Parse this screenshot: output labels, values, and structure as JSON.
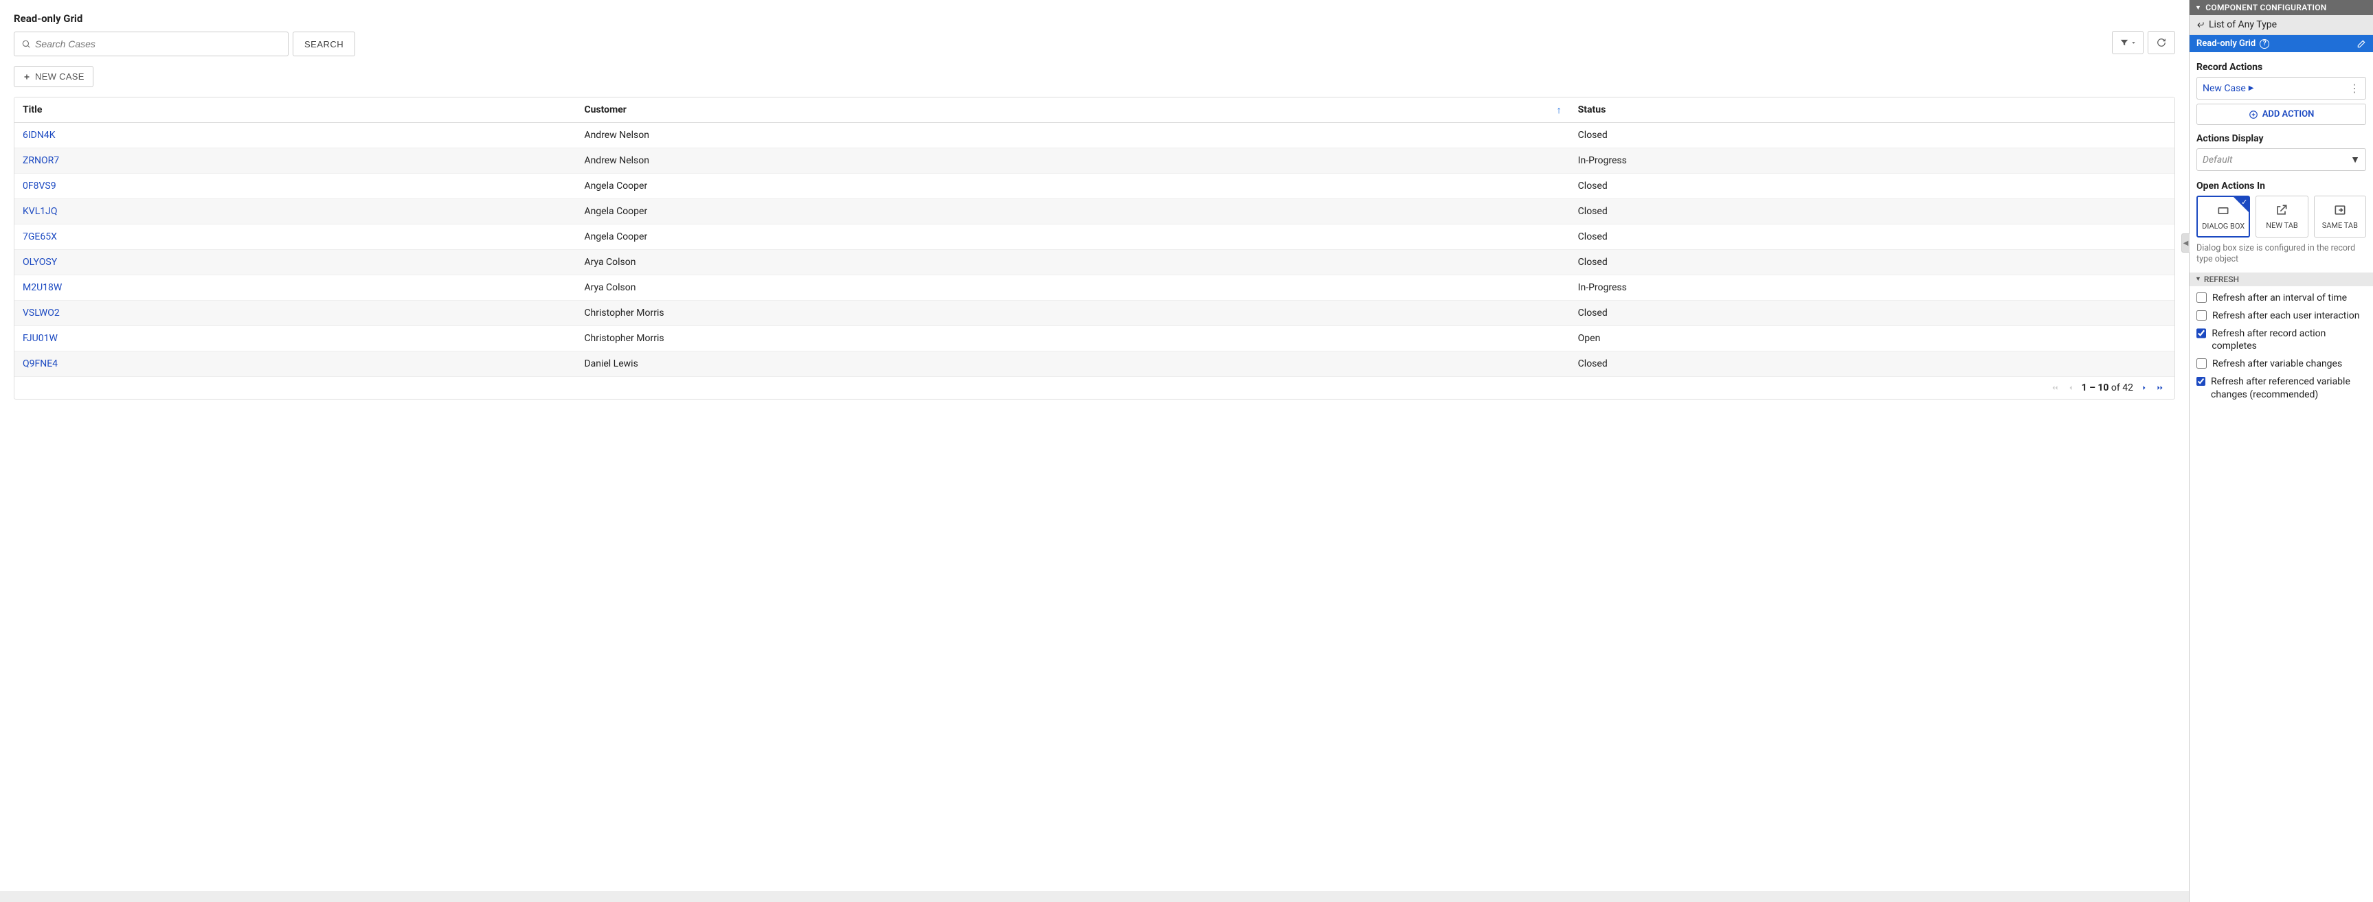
{
  "main": {
    "title": "Read-only Grid",
    "search_placeholder": "Search Cases",
    "search_button": "SEARCH",
    "new_case_button": "NEW CASE"
  },
  "grid": {
    "columns": {
      "title": "Title",
      "customer": "Customer",
      "status": "Status"
    },
    "sorted_column": "customer",
    "rows": [
      {
        "title": "6IDN4K",
        "customer": "Andrew Nelson",
        "status": "Closed"
      },
      {
        "title": "ZRNOR7",
        "customer": "Andrew Nelson",
        "status": "In-Progress"
      },
      {
        "title": "0F8VS9",
        "customer": "Angela Cooper",
        "status": "Closed"
      },
      {
        "title": "KVL1JQ",
        "customer": "Angela Cooper",
        "status": "Closed"
      },
      {
        "title": "7GE65X",
        "customer": "Angela Cooper",
        "status": "Closed"
      },
      {
        "title": "OLYOSY",
        "customer": "Arya Colson",
        "status": "Closed"
      },
      {
        "title": "M2U18W",
        "customer": "Arya Colson",
        "status": "In-Progress"
      },
      {
        "title": "VSLWO2",
        "customer": "Christopher Morris",
        "status": "Closed"
      },
      {
        "title": "FJU01W",
        "customer": "Christopher Morris",
        "status": "Open"
      },
      {
        "title": "Q9FNE4",
        "customer": "Daniel Lewis",
        "status": "Closed"
      }
    ],
    "pagination": {
      "range": "1 – 10",
      "of_label": " of ",
      "total": "42"
    }
  },
  "panel": {
    "header": "COMPONENT CONFIGURATION",
    "breadcrumb": "List of Any Type",
    "section_title": "Read-only Grid",
    "record_actions_label": "Record Actions",
    "action_item": "New Case",
    "add_action_label": "ADD ACTION",
    "actions_display_label": "Actions Display",
    "actions_display_value": "Default",
    "open_actions_label": "Open Actions In",
    "open_options": {
      "dialog": "DIALOG BOX",
      "newtab": "NEW TAB",
      "sametab": "SAME TAB"
    },
    "open_hint": "Dialog box size is configured in the record type object",
    "refresh_header": "REFRESH",
    "refresh_options": {
      "interval": "Refresh after an interval of time",
      "interaction": "Refresh after each user interaction",
      "record_action": "Refresh after record action completes",
      "variable": "Refresh after variable changes",
      "referenced": "Refresh after referenced variable changes (recommended)"
    }
  }
}
